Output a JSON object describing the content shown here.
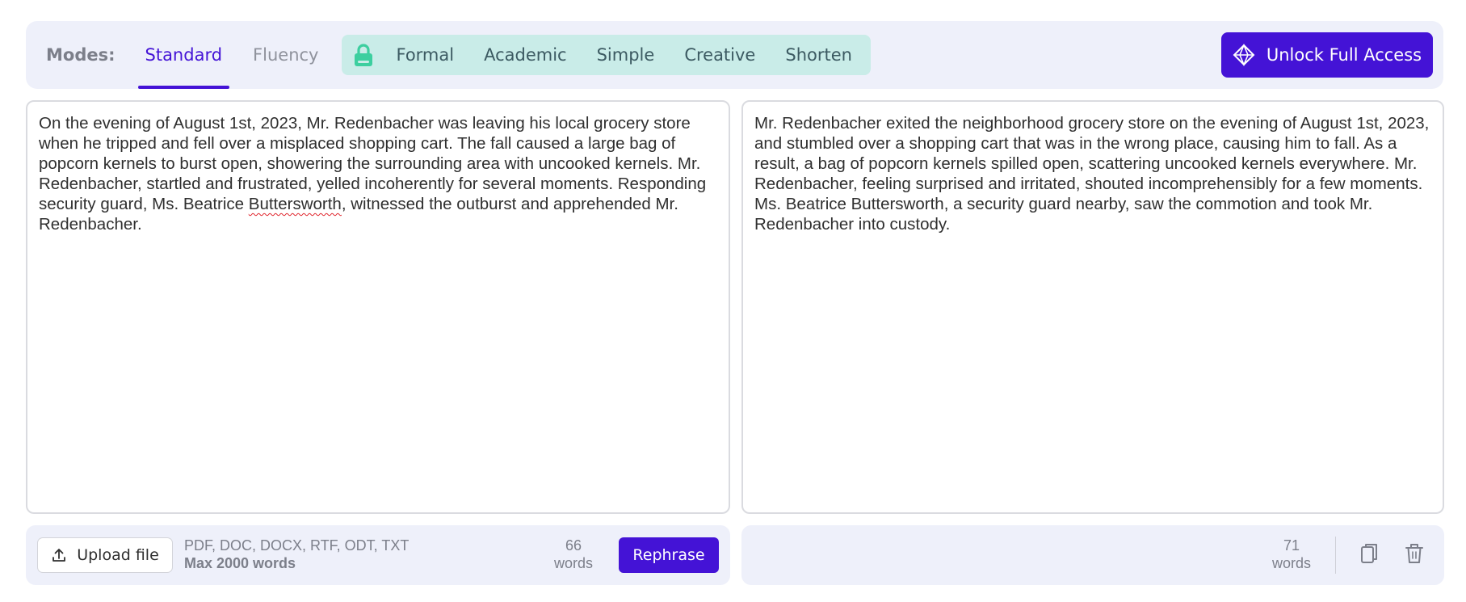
{
  "modebar": {
    "label": "Modes:",
    "tabs": [
      {
        "label": "Standard",
        "active": true
      },
      {
        "label": "Fluency",
        "active": false
      }
    ],
    "premium_icon": "lock-icon",
    "premium_tabs": [
      "Formal",
      "Academic",
      "Simple",
      "Creative",
      "Shorten"
    ],
    "unlock_label": "Unlock Full Access",
    "unlock_icon": "diamond-icon"
  },
  "input": {
    "before_misspelled": "On the evening of August 1st, 2023, Mr. Redenbacher was leaving his local grocery store when he tripped and fell over a misplaced shopping cart. The fall caused a large bag of popcorn kernels to burst open, showering the surrounding area with uncooked kernels. Mr. Redenbacher, startled and frustrated, yelled incoherently for several moments. Responding security guard, Ms. Beatrice ",
    "misspelled": "Buttersworth",
    "after_misspelled": ", witnessed the outburst and apprehended Mr. Redenbacher.",
    "upload_label": "Upload file",
    "formats": "PDF, DOC, DOCX, RTF, ODT, TXT",
    "limit": "Max 2000 words",
    "word_count": "66",
    "word_unit": "words",
    "rephrase_label": "Rephrase"
  },
  "output": {
    "text": "Mr. Redenbacher exited the neighborhood grocery store on the evening of August 1st, 2023, and stumbled over a shopping cart that was in the wrong place, causing him to fall. As a result, a bag of popcorn kernels spilled open, scattering uncooked kernels everywhere. Mr. Redenbacher, feeling surprised and irritated, shouted incomprehensibly for a few moments. Ms. Beatrice Buttersworth, a security guard nearby, saw the commotion and took Mr. Redenbacher into custody.",
    "word_count": "71",
    "word_unit": "words",
    "copy_icon": "copy-icon",
    "trash_icon": "trash-icon"
  },
  "colors": {
    "accent": "#4413d6",
    "premium_bg": "#c9ece8",
    "bar_bg": "#eef0fa",
    "lock": "#3ccf9f"
  }
}
